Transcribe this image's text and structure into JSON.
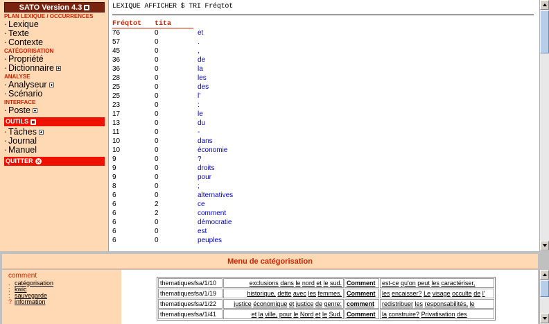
{
  "sidebar": {
    "logo": "SATO Version 4.3",
    "sections": [
      {
        "title": "Plan lexique / occurrences",
        "items": [
          {
            "label": "Lexique"
          },
          {
            "label": "Texte"
          },
          {
            "label": "Contexte"
          }
        ]
      },
      {
        "title": "Catégorisation",
        "items": [
          {
            "label": "Propriété"
          },
          {
            "label": "Dictionnaire",
            "expandable": true
          }
        ]
      },
      {
        "title": "Analyse",
        "items": [
          {
            "label": "Analyseur",
            "expandable": true
          },
          {
            "label": "Scénario"
          }
        ]
      },
      {
        "title": "Interface",
        "items": [
          {
            "label": "Poste",
            "expandable": true
          }
        ]
      }
    ],
    "outils_label": "OUTILS",
    "outils_items": [
      {
        "label": "Tâches",
        "expandable": true
      },
      {
        "label": "Journal"
      },
      {
        "label": "Manuel"
      }
    ],
    "quit_label": "QUITTER"
  },
  "main": {
    "command": "LEXIQUE AFFICHER $ TRI Fréqtot",
    "columns": [
      "Fréqtot",
      "tita"
    ],
    "rows": [
      [
        "76",
        "0",
        "et"
      ],
      [
        "57",
        "0",
        "."
      ],
      [
        "45",
        "0",
        ","
      ],
      [
        "36",
        "0",
        "de"
      ],
      [
        "36",
        "0",
        "la"
      ],
      [
        "28",
        "0",
        "les"
      ],
      [
        "25",
        "0",
        "des"
      ],
      [
        "25",
        "0",
        "l'"
      ],
      [
        "23",
        "0",
        ":"
      ],
      [
        "17",
        "0",
        "le"
      ],
      [
        "13",
        "0",
        "du"
      ],
      [
        "11",
        "0",
        "-"
      ],
      [
        "10",
        "0",
        "dans"
      ],
      [
        "10",
        "0",
        "économie"
      ],
      [
        "9",
        "0",
        "?"
      ],
      [
        "9",
        "0",
        "droits"
      ],
      [
        "9",
        "0",
        "pour"
      ],
      [
        "8",
        "0",
        ";"
      ],
      [
        "6",
        "0",
        "alternatives"
      ],
      [
        "6",
        "2",
        "ce"
      ],
      [
        "6",
        "2",
        "comment"
      ],
      [
        "6",
        "0",
        "démocratie"
      ],
      [
        "6",
        "0",
        "est"
      ],
      [
        "6",
        "0",
        "peuples"
      ]
    ]
  },
  "bottom": {
    "menu_title": "Menu de catégorisation",
    "lead": "comment",
    "links": [
      {
        "prefix": ".",
        "label": "catégorisation"
      },
      {
        "prefix": ";",
        "label": "kwic"
      },
      {
        "prefix": ":",
        "label": "sauvegarde"
      },
      {
        "prefix": "?",
        "label": "information"
      }
    ],
    "concordance": [
      {
        "ref": "thematiquesfsa/1/10",
        "left": [
          "exclusions",
          "dans",
          "le",
          "nord",
          "et",
          "le",
          "sud."
        ],
        "kw": "Comment",
        "right": [
          "est-ce",
          "qu'on",
          "peut",
          "les",
          "caractériser,"
        ]
      },
      {
        "ref": "thematiquesfsa/1/19",
        "left": [
          "historique,",
          "dette",
          "avec",
          "les",
          "femmes."
        ],
        "kw": "Comment",
        "right": [
          "les",
          "encaisser?",
          "Le",
          "visage",
          "occulte",
          "de",
          "l'"
        ]
      },
      {
        "ref": "thematiquesfsa/1/22",
        "left": [
          "justice",
          "économique",
          "et",
          "justice",
          "de",
          "genre:"
        ],
        "kw": "comment",
        "right": [
          "redistribuer",
          "les",
          "responsabilités,",
          "le"
        ]
      },
      {
        "ref": "thematiquesfsa/1/41",
        "left": [
          "et",
          "la",
          "ville,",
          "pour",
          "le",
          "Nord",
          "et",
          "le",
          "Sud."
        ],
        "kw": "Comment",
        "right": [
          "la",
          "construire?",
          "Privatisation",
          "des"
        ]
      }
    ]
  }
}
